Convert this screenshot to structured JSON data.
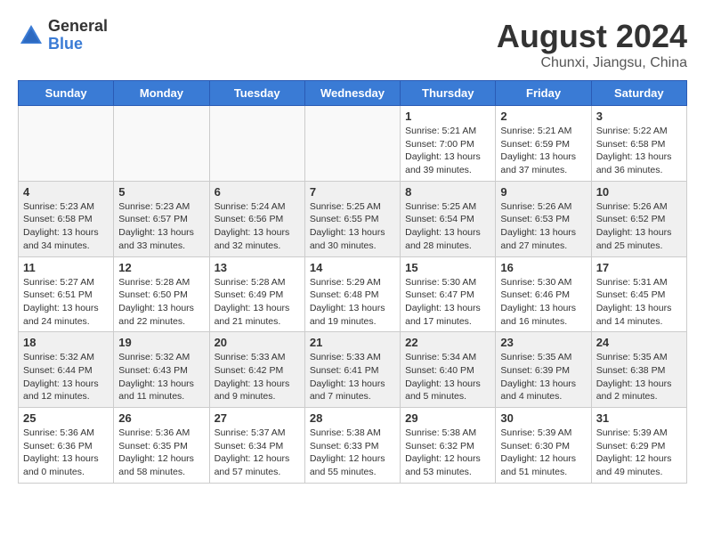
{
  "header": {
    "logo": {
      "general": "General",
      "blue": "Blue"
    },
    "title": "August 2024",
    "location": "Chunxi, Jiangsu, China"
  },
  "weekdays": [
    "Sunday",
    "Monday",
    "Tuesday",
    "Wednesday",
    "Thursday",
    "Friday",
    "Saturday"
  ],
  "weeks": [
    [
      {
        "day": "",
        "info": ""
      },
      {
        "day": "",
        "info": ""
      },
      {
        "day": "",
        "info": ""
      },
      {
        "day": "",
        "info": ""
      },
      {
        "day": "1",
        "info": "Sunrise: 5:21 AM\nSunset: 7:00 PM\nDaylight: 13 hours\nand 39 minutes."
      },
      {
        "day": "2",
        "info": "Sunrise: 5:21 AM\nSunset: 6:59 PM\nDaylight: 13 hours\nand 37 minutes."
      },
      {
        "day": "3",
        "info": "Sunrise: 5:22 AM\nSunset: 6:58 PM\nDaylight: 13 hours\nand 36 minutes."
      }
    ],
    [
      {
        "day": "4",
        "info": "Sunrise: 5:23 AM\nSunset: 6:58 PM\nDaylight: 13 hours\nand 34 minutes."
      },
      {
        "day": "5",
        "info": "Sunrise: 5:23 AM\nSunset: 6:57 PM\nDaylight: 13 hours\nand 33 minutes."
      },
      {
        "day": "6",
        "info": "Sunrise: 5:24 AM\nSunset: 6:56 PM\nDaylight: 13 hours\nand 32 minutes."
      },
      {
        "day": "7",
        "info": "Sunrise: 5:25 AM\nSunset: 6:55 PM\nDaylight: 13 hours\nand 30 minutes."
      },
      {
        "day": "8",
        "info": "Sunrise: 5:25 AM\nSunset: 6:54 PM\nDaylight: 13 hours\nand 28 minutes."
      },
      {
        "day": "9",
        "info": "Sunrise: 5:26 AM\nSunset: 6:53 PM\nDaylight: 13 hours\nand 27 minutes."
      },
      {
        "day": "10",
        "info": "Sunrise: 5:26 AM\nSunset: 6:52 PM\nDaylight: 13 hours\nand 25 minutes."
      }
    ],
    [
      {
        "day": "11",
        "info": "Sunrise: 5:27 AM\nSunset: 6:51 PM\nDaylight: 13 hours\nand 24 minutes."
      },
      {
        "day": "12",
        "info": "Sunrise: 5:28 AM\nSunset: 6:50 PM\nDaylight: 13 hours\nand 22 minutes."
      },
      {
        "day": "13",
        "info": "Sunrise: 5:28 AM\nSunset: 6:49 PM\nDaylight: 13 hours\nand 21 minutes."
      },
      {
        "day": "14",
        "info": "Sunrise: 5:29 AM\nSunset: 6:48 PM\nDaylight: 13 hours\nand 19 minutes."
      },
      {
        "day": "15",
        "info": "Sunrise: 5:30 AM\nSunset: 6:47 PM\nDaylight: 13 hours\nand 17 minutes."
      },
      {
        "day": "16",
        "info": "Sunrise: 5:30 AM\nSunset: 6:46 PM\nDaylight: 13 hours\nand 16 minutes."
      },
      {
        "day": "17",
        "info": "Sunrise: 5:31 AM\nSunset: 6:45 PM\nDaylight: 13 hours\nand 14 minutes."
      }
    ],
    [
      {
        "day": "18",
        "info": "Sunrise: 5:32 AM\nSunset: 6:44 PM\nDaylight: 13 hours\nand 12 minutes."
      },
      {
        "day": "19",
        "info": "Sunrise: 5:32 AM\nSunset: 6:43 PM\nDaylight: 13 hours\nand 11 minutes."
      },
      {
        "day": "20",
        "info": "Sunrise: 5:33 AM\nSunset: 6:42 PM\nDaylight: 13 hours\nand 9 minutes."
      },
      {
        "day": "21",
        "info": "Sunrise: 5:33 AM\nSunset: 6:41 PM\nDaylight: 13 hours\nand 7 minutes."
      },
      {
        "day": "22",
        "info": "Sunrise: 5:34 AM\nSunset: 6:40 PM\nDaylight: 13 hours\nand 5 minutes."
      },
      {
        "day": "23",
        "info": "Sunrise: 5:35 AM\nSunset: 6:39 PM\nDaylight: 13 hours\nand 4 minutes."
      },
      {
        "day": "24",
        "info": "Sunrise: 5:35 AM\nSunset: 6:38 PM\nDaylight: 13 hours\nand 2 minutes."
      }
    ],
    [
      {
        "day": "25",
        "info": "Sunrise: 5:36 AM\nSunset: 6:36 PM\nDaylight: 13 hours\nand 0 minutes."
      },
      {
        "day": "26",
        "info": "Sunrise: 5:36 AM\nSunset: 6:35 PM\nDaylight: 12 hours\nand 58 minutes."
      },
      {
        "day": "27",
        "info": "Sunrise: 5:37 AM\nSunset: 6:34 PM\nDaylight: 12 hours\nand 57 minutes."
      },
      {
        "day": "28",
        "info": "Sunrise: 5:38 AM\nSunset: 6:33 PM\nDaylight: 12 hours\nand 55 minutes."
      },
      {
        "day": "29",
        "info": "Sunrise: 5:38 AM\nSunset: 6:32 PM\nDaylight: 12 hours\nand 53 minutes."
      },
      {
        "day": "30",
        "info": "Sunrise: 5:39 AM\nSunset: 6:30 PM\nDaylight: 12 hours\nand 51 minutes."
      },
      {
        "day": "31",
        "info": "Sunrise: 5:39 AM\nSunset: 6:29 PM\nDaylight: 12 hours\nand 49 minutes."
      }
    ]
  ]
}
